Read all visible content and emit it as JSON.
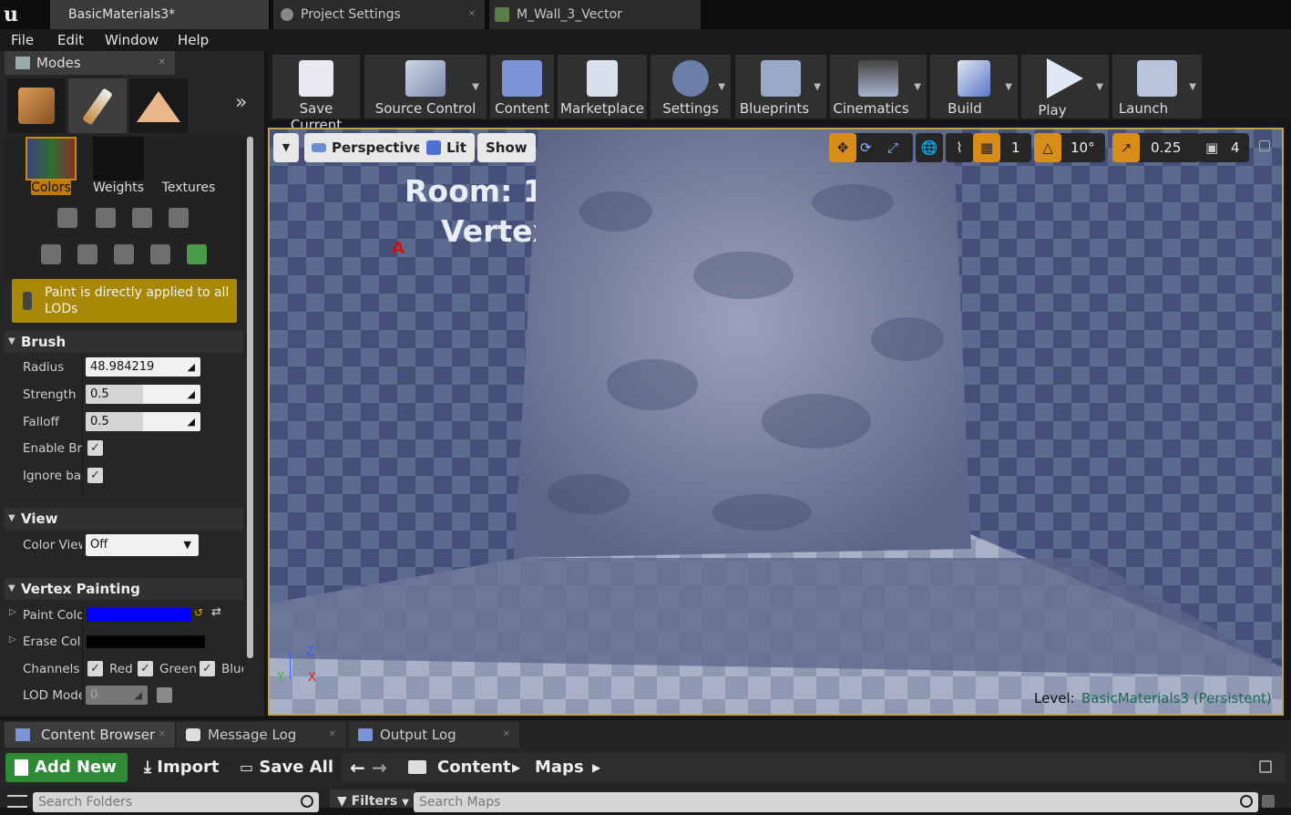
{
  "tabs": [
    {
      "label": "BasicMaterials3*",
      "icon": "level-icon"
    },
    {
      "label": "Project Settings",
      "icon": "settings-icon"
    },
    {
      "label": "M_Wall_3_Vector",
      "icon": "material-icon"
    }
  ],
  "menu": [
    "File",
    "Edit",
    "Window",
    "Help"
  ],
  "modes_panel": {
    "title": "Modes",
    "sub_tools": [
      "Colors",
      "Weights",
      "Textures"
    ],
    "selected_sub_tool": "Colors",
    "warning": "Paint is directly applied to all LODs"
  },
  "brush": {
    "header": "Brush",
    "radius_label": "Radius",
    "radius_value": "48.984219",
    "strength_label": "Strength",
    "strength_value": "0.5",
    "strength_fraction": 0.5,
    "falloff_label": "Falloff",
    "falloff_value": "0.5",
    "falloff_fraction": 0.5,
    "enable_label": "Enable Bru",
    "ignore_label": "Ignore bac"
  },
  "view": {
    "header": "View",
    "color_view_label": "Color View",
    "color_view_value": "Off"
  },
  "vertex_painting": {
    "header": "Vertex Painting",
    "paint_color_label": "Paint Colo",
    "paint_color": "#0000ff",
    "erase_color_label": "Erase Col",
    "erase_color": "#000000",
    "channels_label": "Channels",
    "channels": [
      "Red",
      "Green",
      "Blue"
    ],
    "lod_label": "LOD Mode",
    "lod_value": "0"
  },
  "toolbar": [
    {
      "label": "Save Current",
      "icon": "save-icon"
    },
    {
      "label": "Source Control",
      "icon": "source-control-icon"
    },
    {
      "label": "Content",
      "icon": "content-icon"
    },
    {
      "label": "Marketplace",
      "icon": "marketplace-icon"
    },
    {
      "label": "Settings",
      "icon": "settings-icon"
    },
    {
      "label": "Blueprints",
      "icon": "blueprints-icon"
    },
    {
      "label": "Cinematics",
      "icon": "cinematics-icon"
    },
    {
      "label": "Build",
      "icon": "build-icon"
    },
    {
      "label": "Play",
      "icon": "play-icon"
    },
    {
      "label": "Launch",
      "icon": "launch-icon"
    }
  ],
  "viewport": {
    "perspective": "Perspective",
    "lit": "Lit",
    "show": "Show",
    "grid_snap": "1",
    "rotation_snap": "10°",
    "scale_snap": "0.25",
    "camera_speed": "4",
    "sign_line1": "Room: 1",
    "sign_line2": "Vertex",
    "marker": "A",
    "level_label": "Level:",
    "level_name": "BasicMaterials3 (Persistent)",
    "axis_x": "X",
    "axis_y": "Y",
    "axis_z": "Z"
  },
  "bottom_tabs": [
    "Content Browser",
    "Message Log",
    "Output Log"
  ],
  "content_browser": {
    "add_new": "Add New",
    "import": "Import",
    "save_all": "Save All",
    "breadcrumb": [
      "Content",
      "Maps"
    ],
    "search_folders_placeholder": "Search Folders",
    "filters": "Filters",
    "search_maps_placeholder": "Search Maps"
  },
  "colors": {
    "accent": "#c78a11",
    "warning_bg": "#a88806",
    "viewport_border": "#c4a24b",
    "add_new_bg": "#2e8a34"
  }
}
